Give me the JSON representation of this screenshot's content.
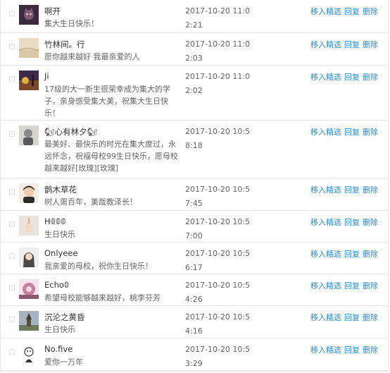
{
  "columns": {
    "actions": {
      "move": "移入精选",
      "reply": "回复",
      "delete": "删除"
    }
  },
  "rows": [
    {
      "name": "啊开",
      "content": "集大生日快乐！",
      "time": "2017-10-20 11:02:21",
      "avatar_icon": "cat-avatar-icon",
      "avatar_color": "#3a2a3c"
    },
    {
      "name": "竹林间。行",
      "content": "愿你越来越好 我最亲爱的人",
      "time": "2017-10-20 11:02:03",
      "avatar_icon": "sand-avatar-icon",
      "avatar_color": "#d9c7a5"
    },
    {
      "name": "Ji",
      "content": "17级的大一新生很荣幸成为集大的学子，亲身感受集大美，祝集大生日快乐！",
      "time": "2017-10-20 11:02:02",
      "avatar_icon": "sunset-avatar-icon",
      "avatar_color": "#e0b040"
    },
    {
      "name": "🐿心有林夕🐿",
      "content": "最美好、最快乐的时光在集大度过，永远怀念，祝福母校99生日快乐，愿母校越来越好[玫瑰][玫瑰]",
      "time": "2017-10-20 10:58:18",
      "avatar_icon": "portrait-avatar-icon",
      "avatar_color": "#8a8a8a"
    },
    {
      "name": "鹊木草花",
      "content": "树人需百年，美哉教泽长！",
      "time": "2017-10-20 10:57:45",
      "avatar_icon": "boy-avatar-icon",
      "avatar_color": "#2e2a28"
    },
    {
      "name": "H𝟘𝟘𝟘",
      "content": "生日快乐",
      "time": "2017-10-20 10:57:00",
      "avatar_icon": "hand-avatar-icon",
      "avatar_color": "#e9e4dc"
    },
    {
      "name": "Onlyeee",
      "content": "我亲爱的母校，祝你生日快乐！",
      "time": "2017-10-20 10:56:17",
      "avatar_icon": "girl-avatar-icon",
      "avatar_color": "#4a4a4a"
    },
    {
      "name": "Echo𝟘",
      "content": "希望母校能够越来越好，桃李芬芳",
      "time": "2017-10-20 10:54:26",
      "avatar_icon": "flower-avatar-icon",
      "avatar_color": "#c97f9a"
    },
    {
      "name": "沉沦之黄昏",
      "content": "生日快乐",
      "time": "2017-10-20 10:54:16",
      "avatar_icon": "tower-avatar-icon",
      "avatar_color": "#6c7c5a"
    },
    {
      "name": "No.five",
      "content": "爱你一万年",
      "time": "2017-10-20 10:53:29",
      "avatar_icon": "cartoon-avatar-icon",
      "avatar_color": "#ffffff"
    }
  ]
}
